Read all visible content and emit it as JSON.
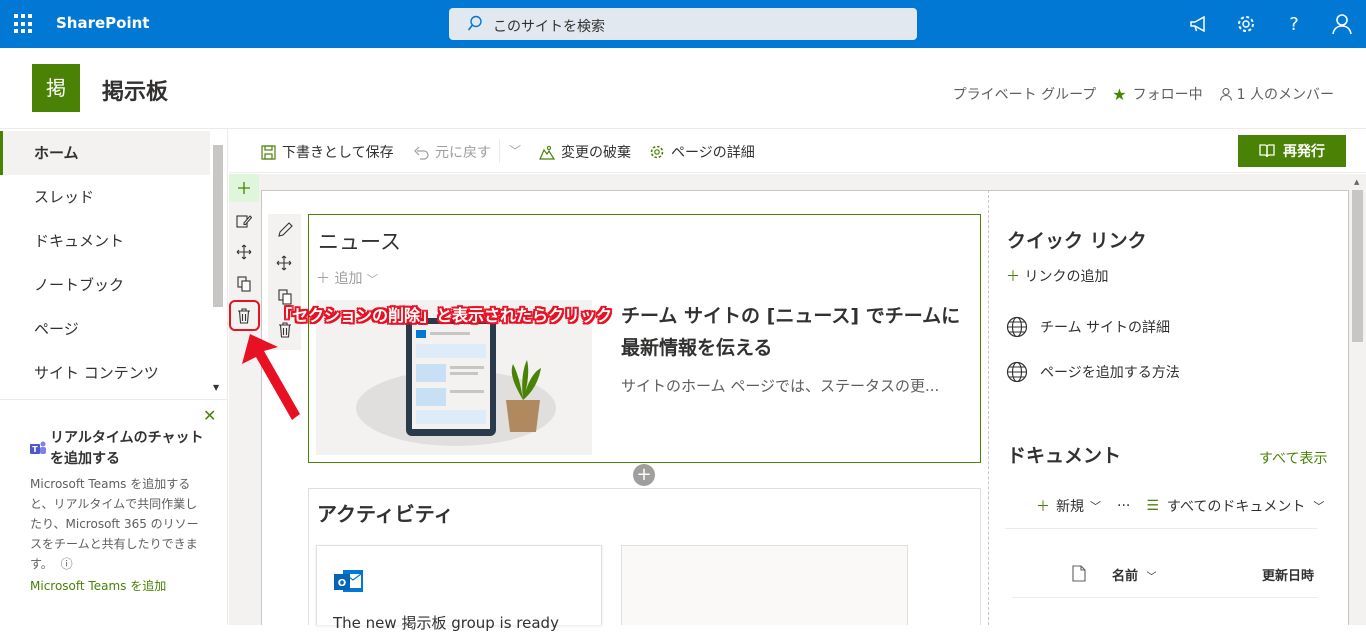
{
  "suite_bar": {
    "brand": "SharePoint",
    "search_placeholder": "このサイトを検索",
    "icons": [
      "waffle-icon",
      "megaphone-icon",
      "gear-icon",
      "help-icon",
      "person-icon"
    ]
  },
  "site": {
    "logo_char": "掲",
    "title": "掲示板",
    "privacy": "プライベート グループ",
    "follow": "フォロー中",
    "members": "1 人のメンバー"
  },
  "leftnav": {
    "items": [
      {
        "label": "ホーム",
        "active": true
      },
      {
        "label": "スレッド"
      },
      {
        "label": "ドキュメント"
      },
      {
        "label": "ノートブック"
      },
      {
        "label": "ページ"
      },
      {
        "label": "サイト コンテンツ"
      }
    ]
  },
  "teams_promo": {
    "title": "リアルタイムのチャットを追加する",
    "description": "Microsoft Teams を追加すると、リアルタイムで共同作業したり、Microsoft 365 のリソースをチームと共有したりできます。",
    "info_icon": "ⓘ",
    "link": "Microsoft Teams を追加"
  },
  "commandbar": {
    "save_draft": "下書きとして保存",
    "undo": "元に戻す",
    "discard": "変更の破棄",
    "page_details": "ページの詳細",
    "republish": "再発行"
  },
  "news": {
    "title": "ニュース",
    "add": "追加",
    "headline": "チーム サイトの [ニュース] でチームに最新情報を伝える",
    "summary": "サイトのホーム ページでは、ステータスの更..."
  },
  "activity": {
    "title": "アクティビティ",
    "card1_text": "The new 掲示板 group is ready"
  },
  "quick_links": {
    "title": "クイック リンク",
    "add": "リンクの追加",
    "links": [
      "チーム サイトの詳細",
      "ページを追加する方法"
    ]
  },
  "documents": {
    "title": "ドキュメント",
    "see_all": "すべて表示",
    "new": "新規",
    "more": "···",
    "view": "すべてのドキュメント",
    "col_name": "名前",
    "col_modified": "更新日時"
  },
  "annotation": "「セクションの削除」と表示されたらクリック",
  "colors": {
    "suite": "#0078d4",
    "theme": "#498205",
    "highlight": "#e81123"
  }
}
